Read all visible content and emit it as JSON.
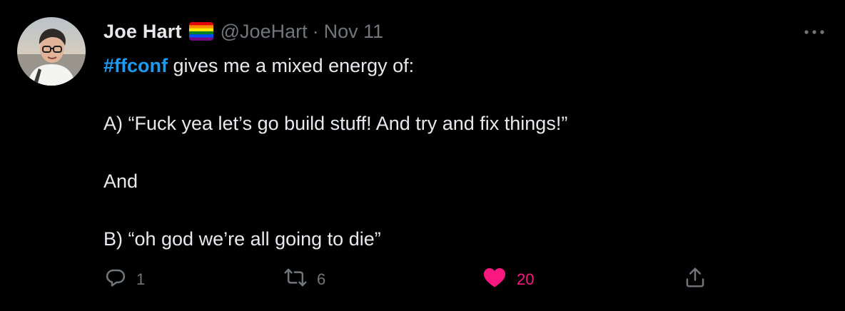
{
  "tweet": {
    "author_name": "Joe Hart",
    "flag_icon": "rainbow-flag-icon",
    "handle": "@JoeHart",
    "separator": "·",
    "date": "Nov 11",
    "more_icon": "more-options-icon",
    "body": {
      "hashtag": "#ffconf",
      "first_line_rest": " gives me a mixed energy of:",
      "line_a": "A) “Fuck yea let’s go build stuff! And try and fix things!”",
      "line_and": "And",
      "line_b": "B) “oh god we’re all going to die”"
    },
    "actions": {
      "reply": {
        "icon": "reply-icon",
        "count": "1"
      },
      "retweet": {
        "icon": "retweet-icon",
        "count": "6"
      },
      "like": {
        "icon": "heart-icon",
        "count": "20",
        "color": "#f91880"
      },
      "share": {
        "icon": "share-icon"
      }
    }
  },
  "colors": {
    "background": "#000000",
    "text": "#e7e9ea",
    "secondary": "#71767b",
    "link": "#1d9bf0",
    "like": "#f91880"
  }
}
